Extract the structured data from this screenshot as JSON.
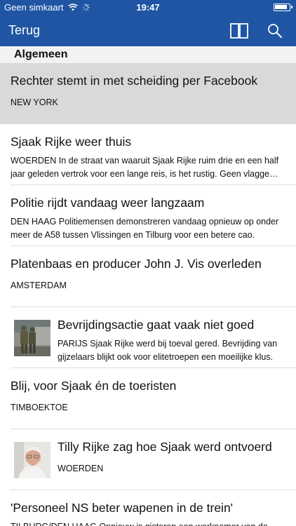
{
  "status": {
    "carrier": "Geen simkaart",
    "time": "19:47"
  },
  "nav": {
    "back_label": "Terug",
    "book_icon": "book-icon",
    "search_icon": "search-icon",
    "bar_color": "#1f55a3"
  },
  "section": {
    "title": "Algemeen"
  },
  "articles": [
    {
      "title": "Rechter stemt in met scheiding per Facebook",
      "summary": "NEW YORK",
      "selected": true,
      "thumb": null
    },
    {
      "title": "Sjaak Rijke weer thuis",
      "summary": "WOERDEN In de straat van waaruit Sjaak Rijke ruim drie en een half jaar geleden vertrok voor een lange reis, is het rustig. Geen vlagge…",
      "selected": false,
      "thumb": null
    },
    {
      "title": "Politie rijdt vandaag weer langzaam",
      "summary": "DEN HAAG Politiemensen demonstreren vandaag opnieuw op onder meer de A58 tussen Vlissingen en Tilburg voor een betere cao.",
      "selected": false,
      "thumb": null
    },
    {
      "title": "Platenbaas en producer John J. Vis overleden",
      "summary": "AMSTERDAM",
      "selected": false,
      "thumb": null
    },
    {
      "title": "Bevrijdingsactie gaat vaak niet goed",
      "summary": "PARIJS Sjaak Rijke werd bij toeval gered. Bevrijding van gijzelaars blijkt ook voor elitetroepen een moeilijke klus.",
      "selected": false,
      "thumb": "soldiers-photo"
    },
    {
      "title": "Blij, voor Sjaak én de toeristen",
      "summary": "TIMBOEKTOE",
      "selected": false,
      "thumb": null
    },
    {
      "title": "Tilly Rijke zag hoe Sjaak werd ontvoerd",
      "summary": "WOERDEN",
      "selected": false,
      "thumb": "portrait-photo"
    },
    {
      "title": "'Personeel NS beter wapenen in de trein'",
      "summary": "TILBURG/DEN HAAG Opnieuw is gisteren een werknemer van de",
      "selected": false,
      "thumb": null
    }
  ]
}
